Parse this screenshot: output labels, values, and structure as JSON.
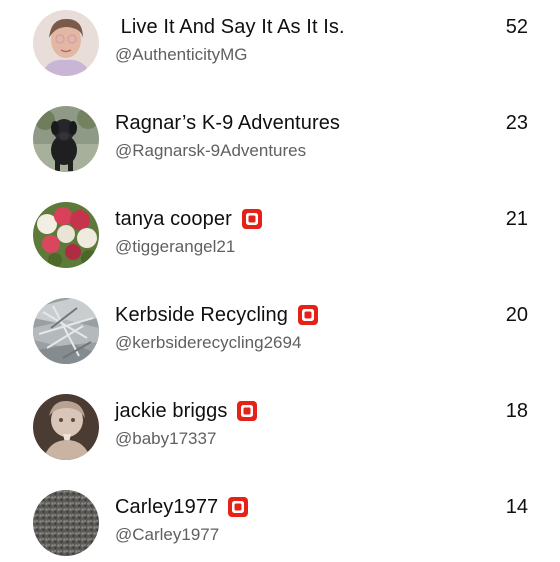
{
  "channels": [
    {
      "name": " Live It And Say It As It Is.",
      "handle": "@AuthenticityMG",
      "count": "52",
      "badge": false,
      "avatar_icon": "woman-portrait-avatar"
    },
    {
      "name": "Ragnar’s K-9 Adventures",
      "handle": "@Ragnarsk-9Adventures",
      "count": "23",
      "badge": false,
      "avatar_icon": "black-dog-avatar"
    },
    {
      "name": "tanya cooper",
      "handle": "@tiggerangel21",
      "count": "21",
      "badge": true,
      "avatar_icon": "roses-bouquet-avatar"
    },
    {
      "name": "Kerbside Recycling",
      "handle": "@kerbsiderecycling2694",
      "count": "20",
      "badge": true,
      "avatar_icon": "scrap-metal-avatar"
    },
    {
      "name": "jackie briggs",
      "handle": "@baby17337",
      "count": "18",
      "badge": true,
      "avatar_icon": "child-praying-avatar"
    },
    {
      "name": "Carley1977",
      "handle": "@Carley1977",
      "count": "14",
      "badge": true,
      "avatar_icon": "gravel-texture-avatar"
    }
  ],
  "colors": {
    "badge_red": "#e62117",
    "name_text": "#0f0f0f",
    "handle_text": "#606060"
  }
}
